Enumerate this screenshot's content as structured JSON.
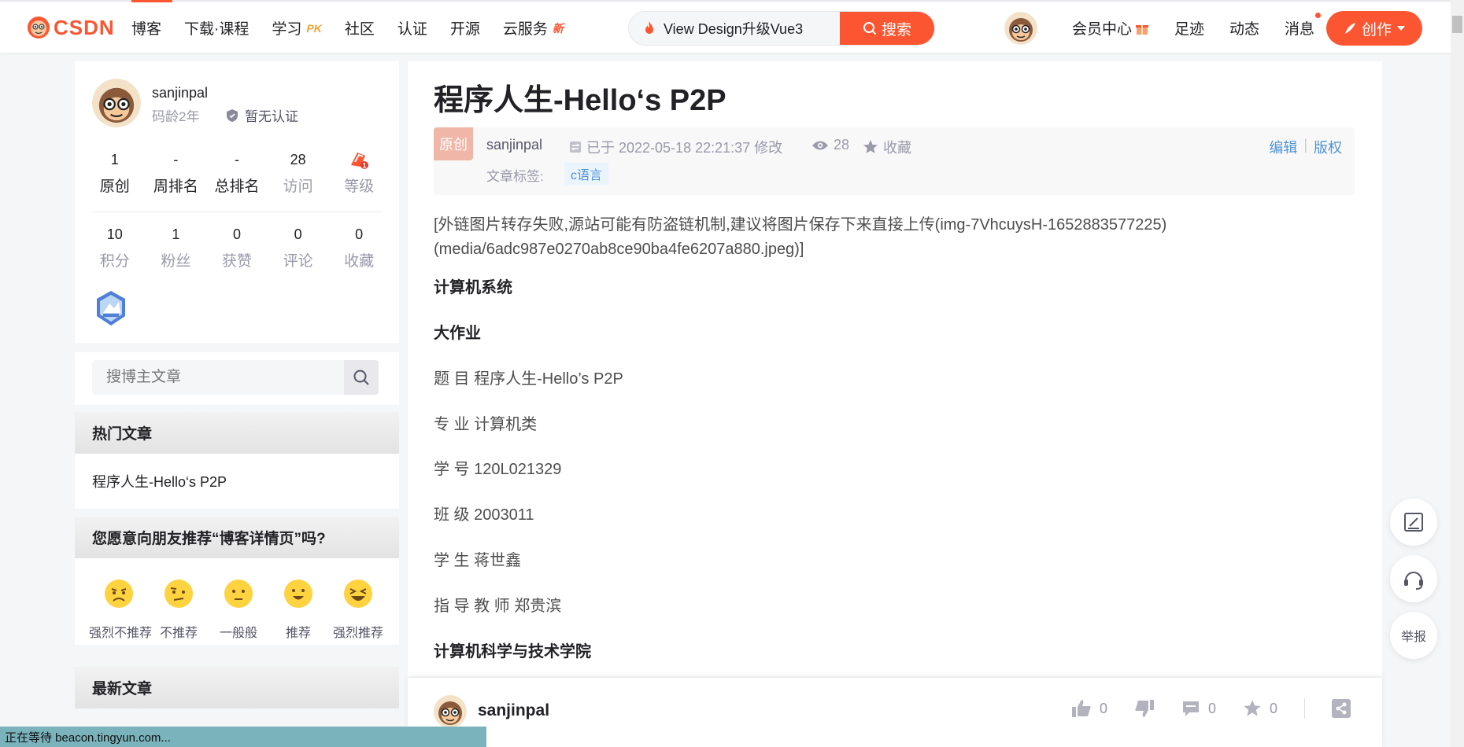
{
  "brand": {
    "logo_text": "CSDN",
    "accent_color": "#fc5531"
  },
  "nav": {
    "items": [
      {
        "label": "博客"
      },
      {
        "label": "下载·课程"
      },
      {
        "label": "学习",
        "badge": "PK"
      },
      {
        "label": "社区"
      },
      {
        "label": "认证"
      },
      {
        "label": "开源"
      },
      {
        "label": "云服务",
        "badge": "新"
      }
    ]
  },
  "search": {
    "value": "View Design升级Vue3",
    "button_label": "搜索"
  },
  "top_right": {
    "member_center": "会员中心",
    "footprint": "足迹",
    "activity": "动态",
    "messages": "消息",
    "create": "创作"
  },
  "profile": {
    "name": "sanjinpal",
    "code_age": "码龄2年",
    "certification": "暂无认证",
    "stats_row1": [
      {
        "value": "1",
        "label": "原创"
      },
      {
        "value": "-",
        "label": "周排名"
      },
      {
        "value": "-",
        "label": "总排名"
      },
      {
        "value": "28",
        "label": "访问"
      },
      {
        "value": "",
        "label": "等级",
        "icon": "level-1-icon"
      }
    ],
    "stats_row2": [
      {
        "value": "10",
        "label": "积分"
      },
      {
        "value": "1",
        "label": "粉丝"
      },
      {
        "value": "0",
        "label": "获赞"
      },
      {
        "value": "0",
        "label": "评论"
      },
      {
        "value": "0",
        "label": "收藏"
      }
    ]
  },
  "sidebar_search": {
    "placeholder": "搜博主文章"
  },
  "hot_articles": {
    "title": "热门文章",
    "items": [
      "程序人生-Hello‘s P2P"
    ]
  },
  "recommend": {
    "title": "您愿意向朋友推荐“博客详情页”吗?",
    "options": [
      "强烈不推荐",
      "不推荐",
      "一般般",
      "推荐",
      "强烈推荐"
    ]
  },
  "latest_articles": {
    "title": "最新文章"
  },
  "article": {
    "title": "程序人生-Hello‘s P2P",
    "original_tag": "原创",
    "author": "sanjinpal",
    "modified": "已于 2022-05-18 22:21:37 修改",
    "views": "28",
    "favorite": "收藏",
    "edit": "编辑",
    "copyright": "版权",
    "tags_label": "文章标签:",
    "tags": [
      "c语言"
    ],
    "paragraphs": [
      {
        "text": "[外链图片转存失败,源站可能有防盗链机制,建议将图片保存下来直接上传(img-7VhcuysH-1652883577225)",
        "bold": false
      },
      {
        "text": "(media/6adc987e0270ab8ce90ba4fe6207a880.jpeg)]",
        "bold": false
      },
      {
        "text": "计算机系统",
        "bold": true
      },
      {
        "text": "大作业",
        "bold": true
      },
      {
        "text": "题 目 程序人生-Hello’s P2P",
        "bold": false
      },
      {
        "text": "专 业 计算机类",
        "bold": false
      },
      {
        "text": "学 号 120L021329",
        "bold": false
      },
      {
        "text": "班 级 2003011",
        "bold": false
      },
      {
        "text": "学 生 蒋世鑫",
        "bold": false
      },
      {
        "text": "指 导 教 师 郑贵滨",
        "bold": false
      },
      {
        "text": "计算机科学与技术学院",
        "bold": true
      }
    ]
  },
  "author_bar": {
    "name": "sanjinpal",
    "likes": "0",
    "comments": "0",
    "favorites": "0"
  },
  "float_tools": {
    "report": "举报"
  },
  "status_bar": "正在等待 beacon.tingyun.com..."
}
